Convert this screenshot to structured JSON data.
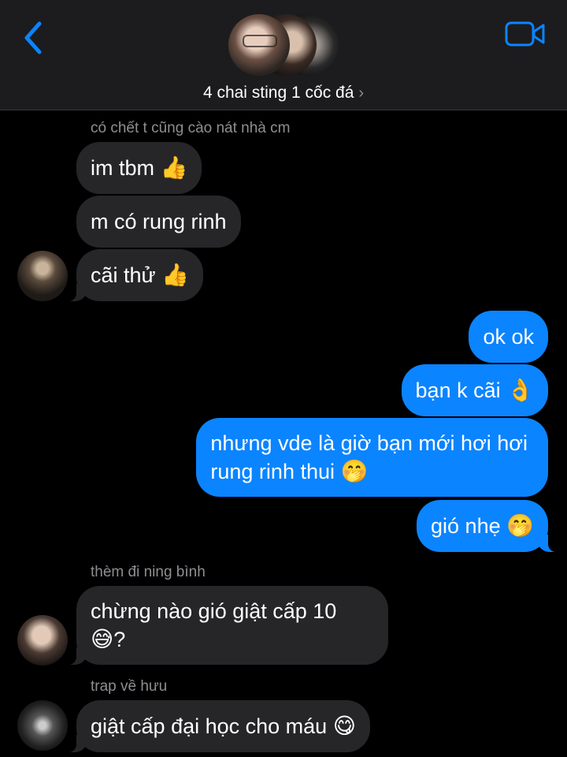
{
  "header": {
    "group_name": "4 chai sting 1 cốc đá",
    "chevron": "›",
    "back_icon": "chevron-left-icon",
    "video_icon": "video-camera-icon",
    "accent": "#0b84ff"
  },
  "messages": {
    "sender1": "có chết t cũng cào nát nhà cm",
    "m1": "im tbm",
    "m1_emoji": "👍",
    "m2": "m có rung rinh",
    "m3": "cãi thử",
    "m3_emoji": "👍",
    "o1": "ok ok",
    "o2": "bạn k cãi",
    "o2_emoji": "👌",
    "o3_line1": "nhưng vde là giờ bạn mới hơi hơi",
    "o3_line2": "rung rinh thui",
    "o3_emoji": "🤭",
    "o4": "gió nhẹ",
    "o4_emoji": "🤭",
    "sender2": "thèm đi ning bình",
    "m4_line1": "chừng nào gió giật cấp 10",
    "m4_emoji": "😅",
    "m4_line2": "?",
    "sender3": "trap về hưu",
    "m5": "giật cấp đại học cho máu",
    "m5_emoji": "😋"
  }
}
